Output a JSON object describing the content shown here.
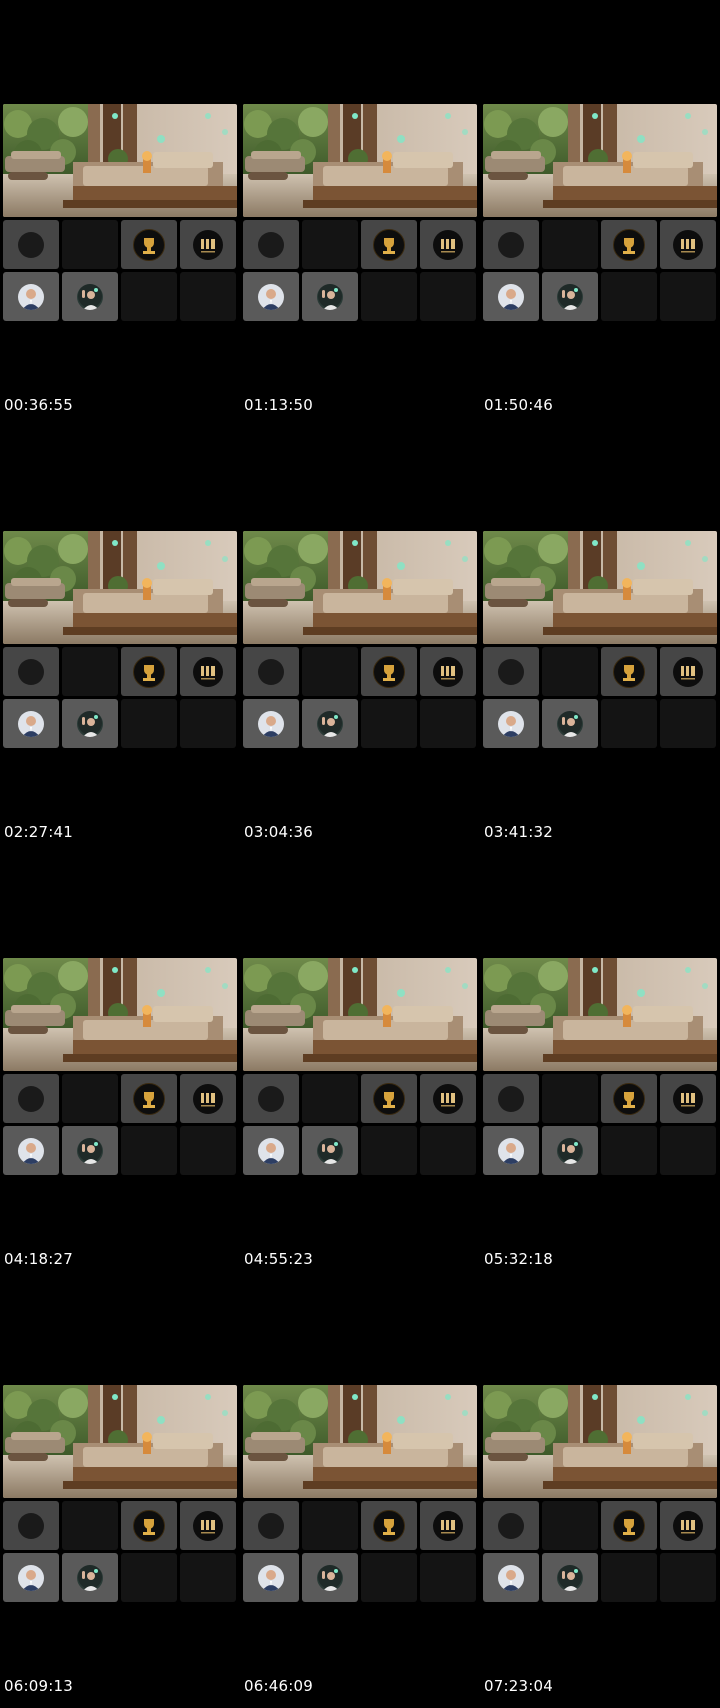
{
  "page": {
    "background": "#000000",
    "accent_teal": "#7fe8c8"
  },
  "frames": [
    {
      "timestamp": "00:36:55"
    },
    {
      "timestamp": "01:13:50"
    },
    {
      "timestamp": "01:50:46"
    },
    {
      "timestamp": "02:27:41"
    },
    {
      "timestamp": "03:04:36"
    },
    {
      "timestamp": "03:41:32"
    },
    {
      "timestamp": "04:18:27"
    },
    {
      "timestamp": "04:55:23"
    },
    {
      "timestamp": "05:32:18"
    },
    {
      "timestamp": "06:09:13"
    },
    {
      "timestamp": "06:46:09"
    },
    {
      "timestamp": "07:23:04"
    }
  ],
  "tiles": {
    "top_row": [
      "logo-dark-circle-icon",
      "empty",
      "gold-trophy-logo-icon",
      "gold-monogram-logo-icon"
    ],
    "bottom_row": [
      "avatar-man-suit",
      "avatar-man-waving",
      "empty",
      "empty"
    ]
  }
}
